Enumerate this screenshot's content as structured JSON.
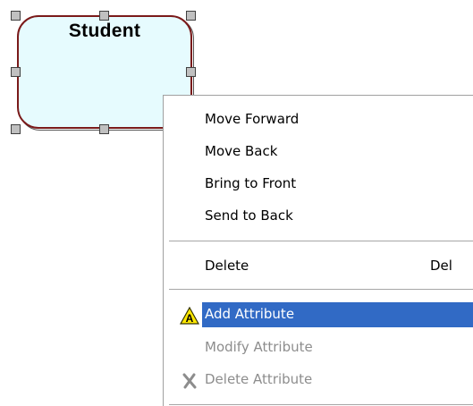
{
  "diagram": {
    "entity_title": "Student",
    "colors": {
      "entity_fill": "#e6fbfe",
      "entity_border": "#7a1a1a",
      "highlight": "#316ac5",
      "disabled_text": "#8d8d8d"
    }
  },
  "context_menu": {
    "items": [
      {
        "label": "Move Forward",
        "shortcut": "",
        "state": "normal",
        "icon": ""
      },
      {
        "label": "Move Back",
        "shortcut": "",
        "state": "normal",
        "icon": ""
      },
      {
        "label": "Bring to Front",
        "shortcut": "",
        "state": "normal",
        "icon": ""
      },
      {
        "label": "Send to Back",
        "shortcut": "",
        "state": "normal",
        "icon": ""
      },
      {
        "label": "Delete",
        "shortcut": "Del",
        "state": "normal",
        "icon": ""
      },
      {
        "label": "Add Attribute",
        "shortcut": "",
        "state": "highlighted",
        "icon": "warning-triangle-icon"
      },
      {
        "label": "Modify Attribute",
        "shortcut": "",
        "state": "disabled",
        "icon": ""
      },
      {
        "label": "Delete Attribute",
        "shortcut": "",
        "state": "disabled",
        "icon": "x-icon"
      }
    ]
  }
}
